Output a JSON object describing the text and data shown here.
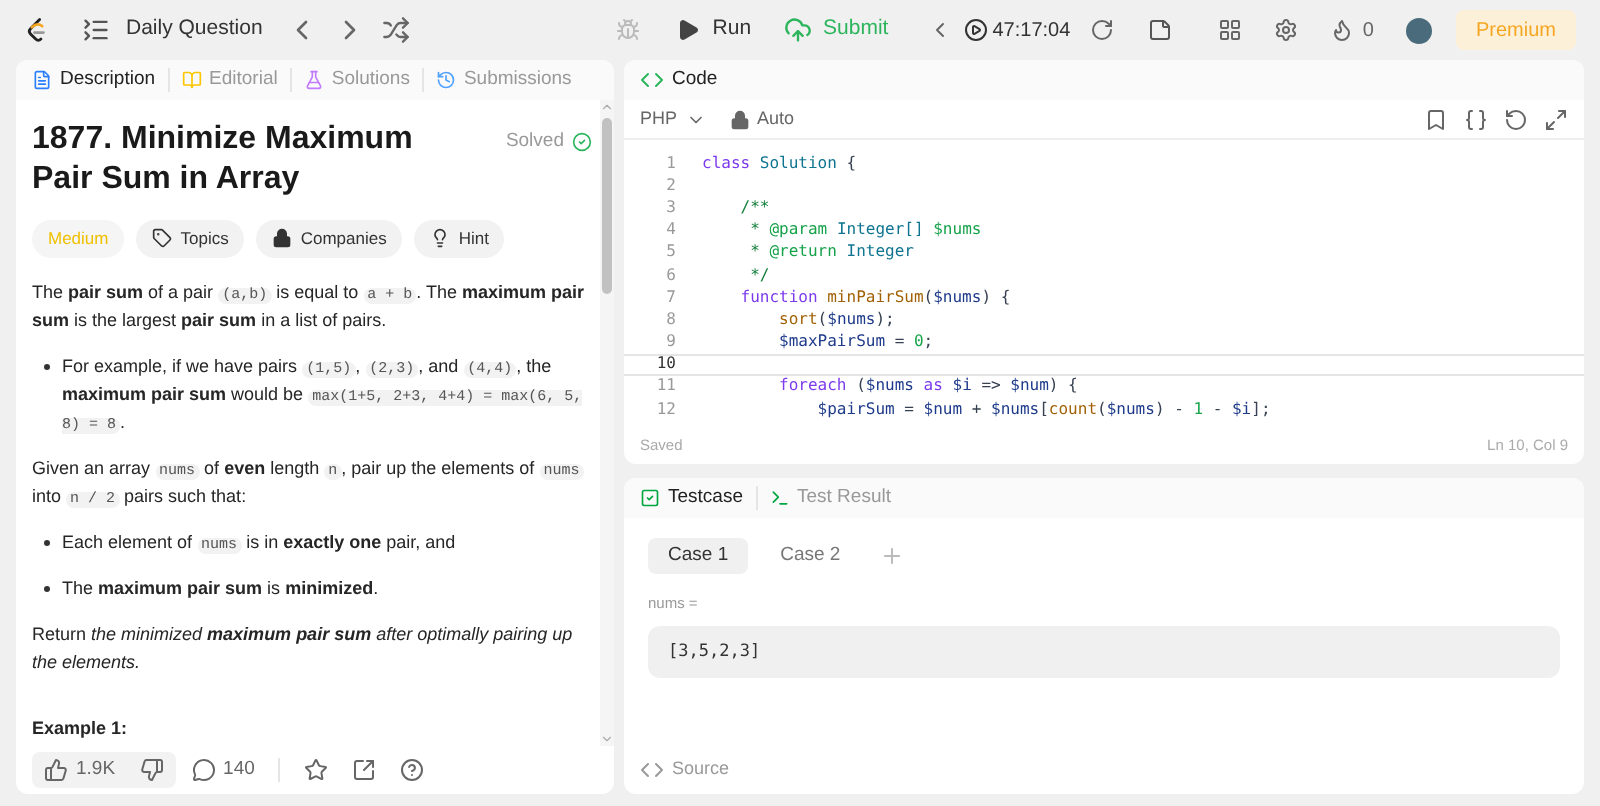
{
  "topbar": {
    "nav_label": "Daily Question",
    "run": "Run",
    "submit": "Submit",
    "timer": "47:17:04",
    "streak": "0",
    "premium": "Premium"
  },
  "description_panel": {
    "tabs": [
      {
        "label": "Description",
        "kind": "description",
        "selected": true
      },
      {
        "label": "Editorial",
        "kind": "editorial",
        "selected": false
      },
      {
        "label": "Solutions",
        "kind": "solutions",
        "selected": false
      },
      {
        "label": "Submissions",
        "kind": "submissions",
        "selected": false
      }
    ],
    "title": "1877. Minimize Maximum Pair Sum in Array",
    "status": "Solved",
    "tags": [
      {
        "kind": "difficulty",
        "label": "Medium"
      },
      {
        "kind": "topics",
        "label": "Topics"
      },
      {
        "kind": "companies",
        "label": "Companies"
      },
      {
        "kind": "hint",
        "label": "Hint"
      }
    ],
    "blocks": [
      {
        "kind": "paragraph",
        "segments": [
          {
            "kind": "text",
            "text": "The **pair sum** of a pair "
          },
          {
            "kind": "code",
            "text": "(a,b)"
          },
          {
            "kind": "text",
            "text": " is equal to "
          },
          {
            "kind": "code",
            "text": "a + b"
          },
          {
            "kind": "text",
            "text": ". The **maximum pair sum** is the largest **pair sum** in a list of pairs."
          }
        ]
      },
      {
        "kind": "bullet",
        "segments": [
          {
            "kind": "text",
            "text": "For example, if we have pairs "
          },
          {
            "kind": "code",
            "text": "(1,5)"
          },
          {
            "kind": "text",
            "text": ", "
          },
          {
            "kind": "code",
            "text": "(2,3)"
          },
          {
            "kind": "text",
            "text": ", and "
          },
          {
            "kind": "code",
            "text": "(4,4)"
          },
          {
            "kind": "text",
            "text": ", the **maximum pair sum** would be "
          },
          {
            "kind": "code",
            "text": "max(1+5, 2+3, 4+4) = max(6, 5, 8) = 8"
          },
          {
            "kind": "text",
            "text": "."
          }
        ]
      },
      {
        "kind": "paragraph",
        "segments": [
          {
            "kind": "text",
            "text": "Given an array "
          },
          {
            "kind": "code",
            "text": "nums"
          },
          {
            "kind": "text",
            "text": " of **even** length "
          },
          {
            "kind": "code",
            "text": "n"
          },
          {
            "kind": "text",
            "text": ", pair up the elements of "
          },
          {
            "kind": "code",
            "text": "nums"
          },
          {
            "kind": "text",
            "text": " into "
          },
          {
            "kind": "code",
            "text": "n / 2"
          },
          {
            "kind": "text",
            "text": " pairs such that:"
          }
        ]
      },
      {
        "kind": "bullet",
        "segments": [
          {
            "kind": "text",
            "text": "Each element of "
          },
          {
            "kind": "code",
            "text": "nums"
          },
          {
            "kind": "text",
            "text": " is in **exactly one** pair, and"
          }
        ]
      },
      {
        "kind": "bullet",
        "segments": [
          {
            "kind": "text",
            "text": "The **maximum pair sum** is **minimized**."
          }
        ]
      },
      {
        "kind": "paragraph",
        "segments": [
          {
            "kind": "text",
            "text": "Return "
          },
          {
            "kind": "em",
            "text": "the minimized **maximum pair sum** after optimally pairing up the elements."
          }
        ]
      },
      {
        "kind": "heading",
        "segments": [
          {
            "kind": "text",
            "text": "Example 1:"
          }
        ]
      }
    ],
    "footer": {
      "likes": "1.9K",
      "comments": "140"
    }
  },
  "code_panel": {
    "tab": "Code",
    "language": "PHP",
    "mode": "Auto",
    "lines": [
      {
        "number": "1",
        "current": false,
        "tokens": [
          {
            "kind": "keyword",
            "text": "class"
          },
          {
            "kind": "type",
            "text": " Solution"
          },
          {
            "kind": "plain",
            "text": " {"
          }
        ]
      },
      {
        "number": "2",
        "current": false
      },
      {
        "number": "3",
        "current": false,
        "tokens": [
          {
            "kind": "comment",
            "text": "    /**"
          }
        ]
      },
      {
        "number": "4",
        "current": false,
        "tokens": [
          {
            "kind": "comment",
            "text": "     * "
          },
          {
            "kind": "tag",
            "text": "@param"
          },
          {
            "kind": "type",
            "text": " Integer[]"
          },
          {
            "kind": "tag",
            "text": " $nums"
          }
        ]
      },
      {
        "number": "5",
        "current": false,
        "tokens": [
          {
            "kind": "comment",
            "text": "     * "
          },
          {
            "kind": "tag",
            "text": "@return"
          },
          {
            "kind": "type",
            "text": " Integer"
          }
        ]
      },
      {
        "number": "6",
        "current": false,
        "tokens": [
          {
            "kind": "comment",
            "text": "     */"
          }
        ]
      },
      {
        "number": "7",
        "current": false,
        "tokens": [
          {
            "kind": "keyword",
            "text": "    function"
          },
          {
            "kind": "function",
            "text": " minPairSum"
          },
          {
            "kind": "plain",
            "text": "("
          },
          {
            "kind": "variable",
            "text": "$nums"
          },
          {
            "kind": "plain",
            "text": ") {"
          }
        ]
      },
      {
        "number": "8",
        "current": false,
        "tokens": [
          {
            "kind": "function",
            "text": "        sort"
          },
          {
            "kind": "plain",
            "text": "("
          },
          {
            "kind": "variable",
            "text": "$nums"
          },
          {
            "kind": "plain",
            "text": ");"
          }
        ]
      },
      {
        "number": "9",
        "current": false,
        "tokens": [
          {
            "kind": "variable",
            "text": "        $maxPairSum"
          },
          {
            "kind": "plain",
            "text": " = "
          },
          {
            "kind": "number",
            "text": "0"
          },
          {
            "kind": "plain",
            "text": ";"
          }
        ]
      },
      {
        "number": "10",
        "current": true
      },
      {
        "number": "11",
        "current": false,
        "tokens": [
          {
            "kind": "keyword",
            "text": "        foreach"
          },
          {
            "kind": "plain",
            "text": " ("
          },
          {
            "kind": "variable",
            "text": "$nums"
          },
          {
            "kind": "keyword",
            "text": " as"
          },
          {
            "kind": "variable",
            "text": " $i"
          },
          {
            "kind": "plain",
            "text": " => "
          },
          {
            "kind": "variable",
            "text": "$num"
          },
          {
            "kind": "plain",
            "text": ") {"
          }
        ]
      },
      {
        "number": "12",
        "current": false,
        "tokens": [
          {
            "kind": "variable",
            "text": "            $pairSum"
          },
          {
            "kind": "plain",
            "text": " = "
          },
          {
            "kind": "variable",
            "text": "$num"
          },
          {
            "kind": "plain",
            "text": " + "
          },
          {
            "kind": "variable",
            "text": "$nums"
          },
          {
            "kind": "plain",
            "text": "["
          },
          {
            "kind": "function",
            "text": "count"
          },
          {
            "kind": "plain",
            "text": "("
          },
          {
            "kind": "variable",
            "text": "$nums"
          },
          {
            "kind": "plain",
            "text": ") - "
          },
          {
            "kind": "number",
            "text": "1"
          },
          {
            "kind": "plain",
            "text": " - "
          },
          {
            "kind": "variable",
            "text": "$i"
          },
          {
            "kind": "plain",
            "text": "];"
          }
        ]
      }
    ],
    "save_status": "Saved",
    "cursor": "Ln 10, Col 9"
  },
  "test_panel": {
    "tabs": [
      {
        "label": "Testcase",
        "kind": "testcase",
        "selected": true
      },
      {
        "label": "Test Result",
        "kind": "result",
        "selected": false
      }
    ],
    "cases": [
      {
        "label": "Case 1",
        "selected": true
      },
      {
        "label": "Case 2",
        "selected": false
      }
    ],
    "inputs": [
      {
        "label": "nums =",
        "value": "[3,5,2,3]"
      }
    ],
    "source": "Source"
  }
}
